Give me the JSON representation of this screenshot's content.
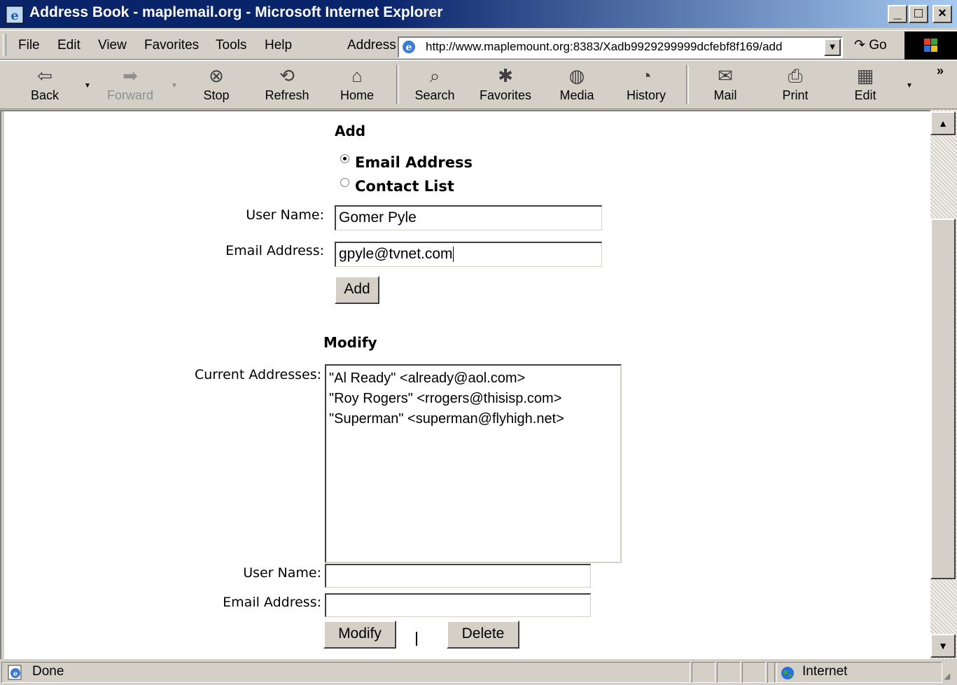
{
  "window": {
    "title": "Address Book - maplemail.org - Microsoft Internet Explorer",
    "controls": {
      "minimize": "_",
      "maximize": "□",
      "close": "×"
    }
  },
  "menubar": {
    "items": [
      "File",
      "Edit",
      "View",
      "Favorites",
      "Tools",
      "Help"
    ],
    "address_label": "Address",
    "address_url": "http://www.maplemount.org:8383/Xadb9929299999dcfebf8f169/add",
    "go_label": "Go"
  },
  "toolbar": {
    "buttons": [
      {
        "label": "Back",
        "icon": "back-arrow-icon",
        "enabled": true
      },
      {
        "label": "Forward",
        "icon": "forward-arrow-icon",
        "enabled": false
      },
      {
        "label": "Stop",
        "icon": "stop-icon",
        "enabled": true
      },
      {
        "label": "Refresh",
        "icon": "refresh-icon",
        "enabled": true
      },
      {
        "label": "Home",
        "icon": "home-icon",
        "enabled": true
      },
      {
        "label": "Search",
        "icon": "search-icon",
        "enabled": true
      },
      {
        "label": "Favorites",
        "icon": "favorites-icon",
        "enabled": true
      },
      {
        "label": "Media",
        "icon": "media-icon",
        "enabled": true
      },
      {
        "label": "History",
        "icon": "history-icon",
        "enabled": true
      },
      {
        "label": "Mail",
        "icon": "mail-icon",
        "enabled": true
      },
      {
        "label": "Print",
        "icon": "print-icon",
        "enabled": true
      },
      {
        "label": "Edit",
        "icon": "edit-icon",
        "enabled": true
      }
    ],
    "overflow": "»"
  },
  "add_section": {
    "heading": "Add",
    "radio_options": [
      {
        "label": "Email Address",
        "selected": true
      },
      {
        "label": "Contact List",
        "selected": false
      }
    ],
    "user_name_label": "User Name:",
    "user_name_value": "Gomer Pyle",
    "email_label": "Email Address:",
    "email_value": "gpyle@tvnet.com",
    "add_button": "Add"
  },
  "modify_section": {
    "heading": "Modify",
    "current_label": "Current Addresses:",
    "addresses": [
      "\"Al Ready\" <already@aol.com>",
      "\"Roy Rogers\" <rrogers@thisisp.com>",
      "\"Superman\" <superman@flyhigh.net>"
    ],
    "user_name_label": "User Name:",
    "user_name_value": "",
    "email_label": "Email Address:",
    "email_value": "",
    "modify_button": "Modify",
    "delete_button": "Delete"
  },
  "statusbar": {
    "status": "Done",
    "zone": "Internet"
  },
  "colors": {
    "titlebar_start": "#0a246a",
    "titlebar_end": "#a6caf0",
    "chrome": "#d4d0c8"
  }
}
